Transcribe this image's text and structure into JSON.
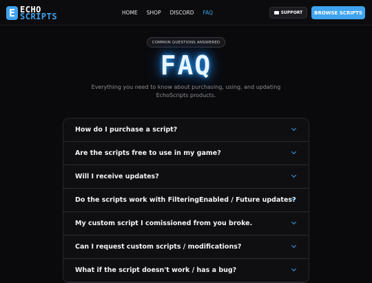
{
  "brand": {
    "logo_letter": "E",
    "line1": "ECHO",
    "line2": "SCRIPTS"
  },
  "nav": {
    "items": [
      {
        "label": "HOME"
      },
      {
        "label": "SHOP"
      },
      {
        "label": "DISCORD"
      },
      {
        "label": "FAQ",
        "active": true
      }
    ],
    "support_label": "SUPPORT",
    "browse_label": "BROWSE SCRIPTS"
  },
  "hero": {
    "pill": "COMMON QUESTIONS ANSWERED",
    "title": "FAQ",
    "subtitle": "Everything you need to know about purchasing, using, and updating EchoScripts products."
  },
  "faq": {
    "questions": [
      "How do I purchase a script?",
      "Are the scripts free to use in my game?",
      "Will I receive updates?",
      "Do the scripts work with FilteringEnabled / Future updates?",
      "My custom script I comissioned from you broke.",
      "Can I request custom scripts / modifications?",
      "What if the script doesn't work / has a bug?"
    ]
  },
  "colors": {
    "accent": "#3fa3ef",
    "background": "#0a0a0c"
  },
  "icons": {
    "support": "ticket-icon",
    "expand": "chevron-down-icon"
  }
}
